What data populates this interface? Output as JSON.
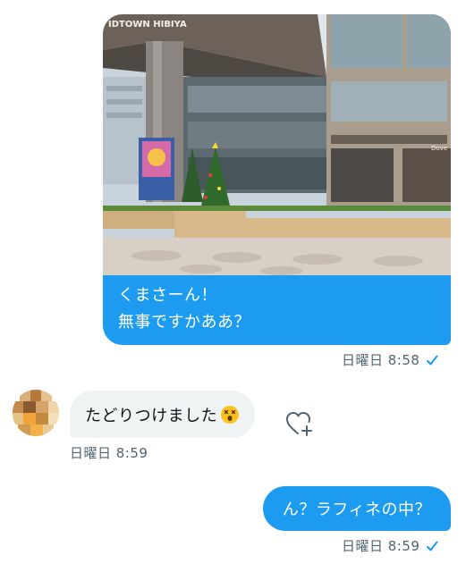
{
  "messages": {
    "photo_message": {
      "image_alt": "Photo of a shopping mall plaza with a Christmas tree",
      "caption": "くまさーん！\n無事ですかああ？",
      "timestamp": "日曜日 8:58",
      "read_icon": "check-icon"
    },
    "incoming_message": {
      "text": "たどりつけました",
      "emoji_icon": "dizzy-face-emoji-icon",
      "timestamp": "日曜日 8:59",
      "reaction_icon": "add-reaction-heart-icon"
    },
    "outgoing_message": {
      "text": "ん？ラフィネの中？",
      "timestamp": "日曜日 8:59",
      "read_icon": "check-icon"
    }
  },
  "colors": {
    "outgoing_bubble": "#1d9bf0",
    "incoming_bubble": "#eff3f4",
    "timestamp_text": "#536471",
    "check": "#1d9bf0"
  }
}
